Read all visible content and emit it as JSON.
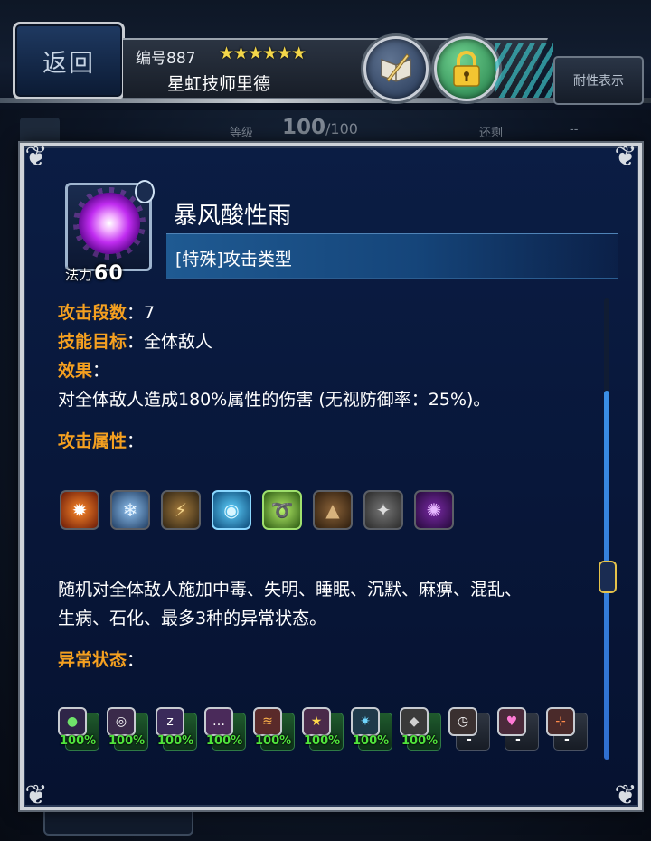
{
  "header": {
    "back_label": "返回",
    "serial": "编号887",
    "stars": "★★★★★★",
    "character_name": "星虹技师里德",
    "resist_label": "耐性表示",
    "level_label": "等级",
    "level_value": "100",
    "level_max": "/100",
    "remaining_label": "还剩",
    "remaining_value": "--",
    "book_icon": "quill-book-icon",
    "lock_icon": "padlock-icon"
  },
  "skill": {
    "name": "暴风酸性雨",
    "type": "[特殊]攻击类型",
    "mp_label": "法力",
    "mp_value": "60",
    "hits_label": "攻击段数",
    "hits_value": "：7",
    "target_label": "技能目标",
    "target_value": "：全体敌人",
    "effect_label": "效果",
    "effect_colon": "：",
    "effect_text": "对全体敌人造成180%属性的伤害 (无视防御率：25%)。",
    "attr_label": "攻击属性",
    "attr_colon": "：",
    "status_desc_line1": "随机对全体敌人施加中毒、失明、睡眠、沉默、麻痹、混乱、",
    "status_desc_line2": "生病、石化、最多3种的异常状态。",
    "status_label": "异常状态",
    "status_colon": "："
  },
  "elements": [
    {
      "name": "fire",
      "glyph": "✹"
    },
    {
      "name": "ice",
      "glyph": "❄"
    },
    {
      "name": "thunder",
      "glyph": "⚡"
    },
    {
      "name": "water",
      "glyph": "◉"
    },
    {
      "name": "wind",
      "glyph": "➰"
    },
    {
      "name": "earth",
      "glyph": "▲"
    },
    {
      "name": "holy",
      "glyph": "✦"
    },
    {
      "name": "dark",
      "glyph": "✺"
    }
  ],
  "ailments": [
    {
      "name": "poison",
      "glyph": "●",
      "value": "100%"
    },
    {
      "name": "blind",
      "glyph": "◎",
      "value": "100%"
    },
    {
      "name": "sleep",
      "glyph": "z",
      "value": "100%"
    },
    {
      "name": "silence",
      "glyph": "…",
      "value": "100%"
    },
    {
      "name": "paralyze",
      "glyph": "≋",
      "value": "100%"
    },
    {
      "name": "confuse",
      "glyph": "★",
      "value": "100%"
    },
    {
      "name": "disease",
      "glyph": "✷",
      "value": "100%"
    },
    {
      "name": "petrify",
      "glyph": "◆",
      "value": "100%"
    },
    {
      "name": "stop",
      "glyph": "◷",
      "value": "-"
    },
    {
      "name": "charm",
      "glyph": "♥",
      "value": "-"
    },
    {
      "name": "break",
      "glyph": "⊹",
      "value": "-"
    }
  ],
  "colors": {
    "accent_orange": "#f5a020",
    "percent_green": "#4fe33c",
    "dialog_bg": "#0b1d44"
  }
}
